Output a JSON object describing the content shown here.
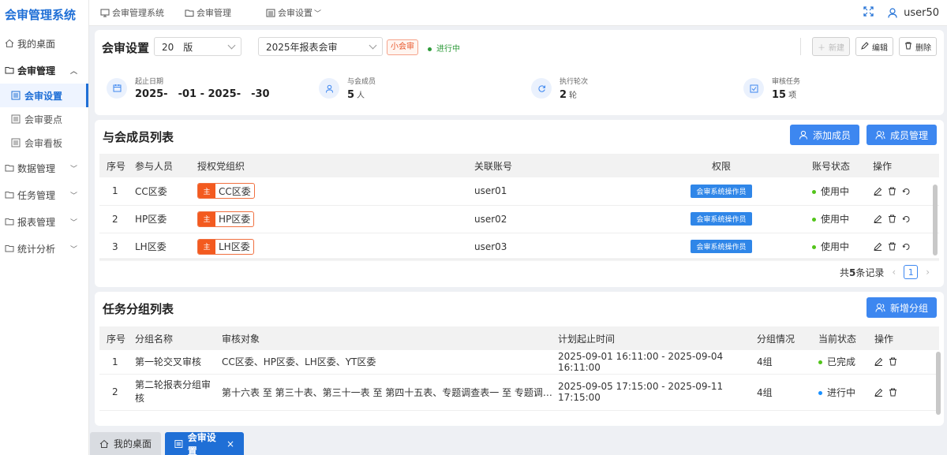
{
  "app": {
    "title": "会审管理系统"
  },
  "sidebar": {
    "items": [
      {
        "label": "我的桌面"
      },
      {
        "label": "会审管理",
        "expanded": true,
        "children": [
          {
            "label": "会审设置",
            "active": true
          },
          {
            "label": "会审要点"
          },
          {
            "label": "会审看板"
          }
        ]
      },
      {
        "label": "数据管理"
      },
      {
        "label": "任务管理"
      },
      {
        "label": "报表管理"
      },
      {
        "label": "统计分析"
      }
    ]
  },
  "topbar": {
    "breadcrumbs": [
      "会审管理系统",
      "会审设置"
    ],
    "user": "user50"
  },
  "settings": {
    "title": "会审设置",
    "version_select": "20 版",
    "review_select": "2025年报表会审",
    "tag": "小会审",
    "status": "进行中",
    "buttons": {
      "new": "新建",
      "edit": "编辑",
      "delete": "删除"
    },
    "stats": [
      {
        "label": "起止日期",
        "value": "2025- -01 - 2025- -30",
        "unit": ""
      },
      {
        "label": "与会成员",
        "value": "5",
        "unit": "人"
      },
      {
        "label": "执行轮次",
        "value": "2",
        "unit": "轮"
      },
      {
        "label": "审核任务",
        "value": "15",
        "unit": "项"
      }
    ]
  },
  "members": {
    "title": "与会成员列表",
    "buttons": {
      "add": "添加成员",
      "manage": "成员管理"
    },
    "columns": [
      "序号",
      "参与人员",
      "授权党组织",
      "关联账号",
      "权限",
      "账号状态",
      "操作"
    ],
    "rows": [
      {
        "no": "1",
        "name": "CC区委",
        "org_tag": "主",
        "org": "CC区委",
        "account": "user01",
        "perm": "会审系统操作员",
        "status": "使用中"
      },
      {
        "no": "2",
        "name": "HP区委",
        "org_tag": "主",
        "org": "HP区委",
        "account": "user02",
        "perm": "会审系统操作员",
        "status": "使用中"
      },
      {
        "no": "3",
        "name": "LH区委",
        "org_tag": "主",
        "org": "LH区委",
        "account": "user03",
        "perm": "会审系统操作员",
        "status": "使用中"
      }
    ],
    "pagination": {
      "total_prefix": "共",
      "total": "5",
      "total_suffix": "条记录",
      "page": "1"
    }
  },
  "groups": {
    "title": "任务分组列表",
    "buttons": {
      "add": "新增分组"
    },
    "columns": [
      "序号",
      "分组名称",
      "审核对象",
      "计划起止时间",
      "分组情况",
      "当前状态",
      "操作"
    ],
    "rows": [
      {
        "no": "1",
        "name": "第一轮交叉审核",
        "targets": "CC区委、HP区委、LH区委、YT区委",
        "time": "2025-09-01 16:11:00 - 2025-09-04 16:11:00",
        "groups": "4组",
        "status": "已完成",
        "status_color": "#52c41a"
      },
      {
        "no": "2",
        "name": "第二轮报表分组审核",
        "targets": "第十六表 至 第三十表、第三十一表 至 第四十五表、专题调查表一 至 专题调查表...",
        "time": "2025-09-05 17:15:00 - 2025-09-11 17:15:00",
        "groups": "4组",
        "status": "进行中",
        "status_color": "#1890ff"
      }
    ]
  },
  "tabs": [
    {
      "label": "我的桌面",
      "active": false
    },
    {
      "label": "会审设置",
      "active": true
    }
  ],
  "colors": {
    "accent": "#3d87f0",
    "brand": "#1f6fd6",
    "orange": "#f35a1f"
  }
}
